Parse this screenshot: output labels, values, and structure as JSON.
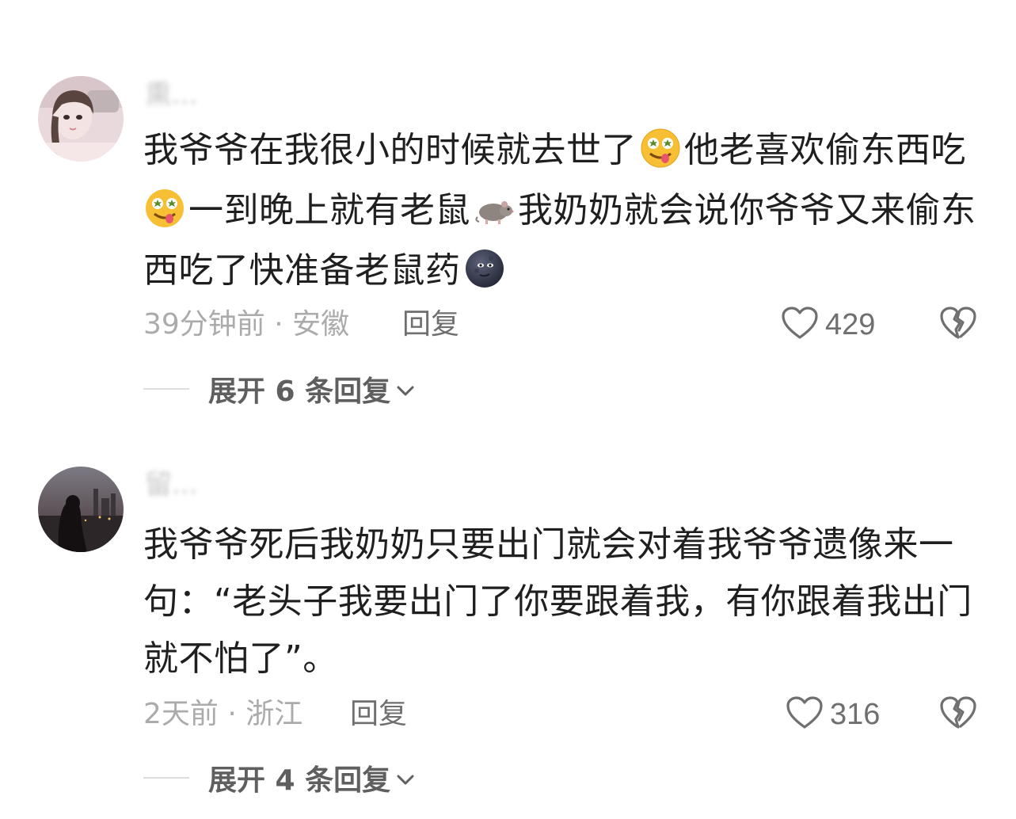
{
  "comments": [
    {
      "username": "熏...",
      "lines": [
        [
          "我爷爷在我很小的时候就去世了",
          "drool-emoji",
          "他老喜欢偷东西吃"
        ],
        [
          "drool-emoji",
          "一到晚上就有老鼠",
          "rat-emoji",
          "我奶奶就会说你爷爷又来偷东"
        ],
        [
          "西吃了快准备老鼠药",
          "moon-face-emoji"
        ]
      ],
      "time_location": "39分钟前 · 安徽",
      "reply_label": "回复",
      "like_count": "429",
      "expand_label": "展开 6 条回复"
    },
    {
      "username": "留...",
      "lines": [
        [
          "我爷爷死后我奶奶只要出门就会对着我爷爷遗像来一"
        ],
        [
          "句：“老头子我要出门了你要跟着我，有你跟着我出门"
        ],
        [
          "就不怕了”。"
        ]
      ],
      "time_location": "2天前 · 浙江",
      "reply_label": "回复",
      "like_count": "316",
      "expand_label": "展开 4 条回复"
    }
  ],
  "colors": {
    "text": "#1f1f1f",
    "meta": "#ababab",
    "action": "#6f6f6f"
  }
}
